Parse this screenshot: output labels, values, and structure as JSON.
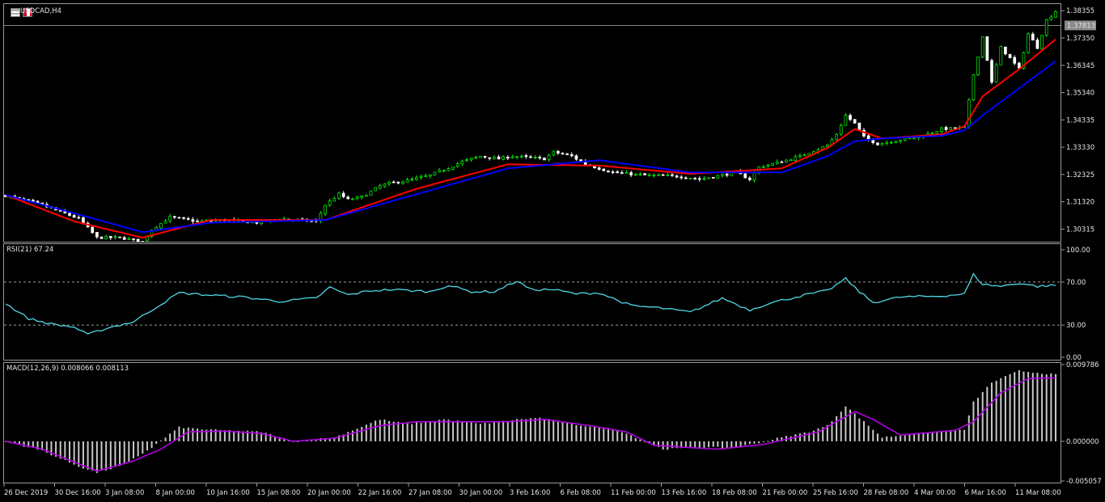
{
  "window": {
    "symbol_label": "USDCAD,H4"
  },
  "price_axis": {
    "ticks": [
      "1.38355",
      "1.37350",
      "1.36345",
      "1.35340",
      "1.34335",
      "1.33330",
      "1.32325",
      "1.31320",
      "1.30315"
    ],
    "current_price": "1.37813"
  },
  "rsi": {
    "label": "RSI(21) 67.24",
    "ticks": [
      "100.00",
      "70.00",
      "30.00",
      "0.00"
    ]
  },
  "macd": {
    "label": "MACD(12,26,9) 0.008066 0.008113",
    "ticks": [
      "0.009786",
      "0.000000",
      "-0.005057"
    ]
  },
  "time_axis": {
    "labels": [
      "26 Dec 2019",
      "30 Dec 16:00",
      "3 Jan 08:00",
      "8 Jan 00:00",
      "10 Jan 16:00",
      "15 Jan 08:00",
      "20 Jan 00:00",
      "22 Jan 16:00",
      "27 Jan 08:00",
      "30 Jan 00:00",
      "3 Feb 16:00",
      "6 Feb 08:00",
      "11 Feb 00:00",
      "13 Feb 16:00",
      "18 Feb 08:00",
      "21 Feb 00:00",
      "25 Feb 16:00",
      "28 Feb 08:00",
      "4 Mar 00:00",
      "6 Mar 16:00",
      "11 Mar 08:00"
    ]
  },
  "colors": {
    "background": "#000000",
    "bull_candle": "#00ff00",
    "bear_candle": "#ffffff",
    "ma_fast": "#ff0000",
    "ma_slow": "#0000ff",
    "rsi_line": "#4fd8e6",
    "macd_histogram": "#c8c8c8",
    "macd_signal": "#b000e0",
    "grid_frame": "#9a9a9a"
  },
  "chart_data": [
    {
      "type": "candlestick",
      "symbol": "USDCAD",
      "timeframe": "H4",
      "ylim": [
        1.2985,
        1.386
      ],
      "close_path": [
        [
          0,
          1.3155
        ],
        [
          8,
          1.312
        ],
        [
          16,
          1.307
        ],
        [
          20,
          1.3
        ],
        [
          25,
          1.3
        ],
        [
          30,
          1.2985
        ],
        [
          32,
          1.303
        ],
        [
          36,
          1.3075
        ],
        [
          42,
          1.306
        ],
        [
          48,
          1.3065
        ],
        [
          55,
          1.3055
        ],
        [
          60,
          1.307
        ],
        [
          68,
          1.306
        ],
        [
          70,
          1.312
        ],
        [
          73,
          1.316
        ],
        [
          75,
          1.314
        ],
        [
          78,
          1.315
        ],
        [
          82,
          1.319
        ],
        [
          84,
          1.32
        ],
        [
          88,
          1.321
        ],
        [
          93,
          1.323
        ],
        [
          96,
          1.325
        ],
        [
          100,
          1.328
        ],
        [
          104,
          1.33
        ],
        [
          108,
          1.329
        ],
        [
          111,
          1.33
        ],
        [
          118,
          1.329
        ],
        [
          120,
          1.3315
        ],
        [
          124,
          1.33
        ],
        [
          127,
          1.327
        ],
        [
          133,
          1.324
        ],
        [
          140,
          1.323
        ],
        [
          148,
          1.3225
        ],
        [
          152,
          1.3215
        ],
        [
          160,
          1.324
        ],
        [
          163,
          1.3215
        ],
        [
          165,
          1.326
        ],
        [
          170,
          1.328
        ],
        [
          174,
          1.33
        ],
        [
          177,
          1.332
        ],
        [
          180,
          1.334
        ],
        [
          182,
          1.338
        ],
        [
          184,
          1.345
        ],
        [
          186,
          1.342
        ],
        [
          188,
          1.337
        ],
        [
          191,
          1.3345
        ],
        [
          194,
          1.3355
        ],
        [
          200,
          1.337
        ],
        [
          205,
          1.34
        ],
        [
          210,
          1.3405
        ],
        [
          212,
          1.36
        ],
        [
          214,
          1.374
        ],
        [
          216,
          1.357
        ],
        [
          218,
          1.37
        ],
        [
          222,
          1.362
        ],
        [
          224,
          1.375
        ],
        [
          226,
          1.37
        ],
        [
          228,
          1.38
        ],
        [
          230,
          1.3833
        ]
      ],
      "moving_averages": [
        {
          "color": "#ff0000",
          "path": [
            [
              0,
              1.3157
            ],
            [
              15,
              1.306
            ],
            [
              30,
              1.3
            ],
            [
              45,
              1.3065
            ],
            [
              70,
              1.3065
            ],
            [
              90,
              1.318
            ],
            [
              110,
              1.327
            ],
            [
              130,
              1.3265
            ],
            [
              150,
              1.3235
            ],
            [
              170,
              1.3255
            ],
            [
              180,
              1.333
            ],
            [
              186,
              1.34
            ],
            [
              192,
              1.3365
            ],
            [
              205,
              1.338
            ],
            [
              210,
              1.341
            ],
            [
              214,
              1.352
            ],
            [
              222,
              1.362
            ],
            [
              230,
              1.373
            ]
          ]
        },
        {
          "color": "#0000ff",
          "path": [
            [
              0,
              1.3157
            ],
            [
              15,
              1.309
            ],
            [
              30,
              1.302
            ],
            [
              45,
              1.3055
            ],
            [
              70,
              1.3065
            ],
            [
              90,
              1.316
            ],
            [
              110,
              1.3255
            ],
            [
              130,
              1.3285
            ],
            [
              150,
              1.324
            ],
            [
              170,
              1.324
            ],
            [
              180,
              1.33
            ],
            [
              186,
              1.3355
            ],
            [
              192,
              1.3365
            ],
            [
              205,
              1.3375
            ],
            [
              210,
              1.3395
            ],
            [
              214,
              1.345
            ],
            [
              222,
              1.355
            ],
            [
              230,
              1.365
            ]
          ]
        }
      ]
    },
    {
      "type": "line",
      "name": "RSI(21)",
      "ylim": [
        0,
        100
      ],
      "levels": [
        70,
        30
      ],
      "path": [
        [
          0,
          50
        ],
        [
          5,
          36
        ],
        [
          10,
          31
        ],
        [
          15,
          28
        ],
        [
          18,
          21
        ],
        [
          22,
          27
        ],
        [
          28,
          33
        ],
        [
          32,
          44
        ],
        [
          38,
          60
        ],
        [
          44,
          58
        ],
        [
          52,
          56
        ],
        [
          60,
          52
        ],
        [
          68,
          55
        ],
        [
          71,
          65
        ],
        [
          75,
          58
        ],
        [
          80,
          62
        ],
        [
          85,
          63
        ],
        [
          93,
          61
        ],
        [
          97,
          67
        ],
        [
          102,
          61
        ],
        [
          107,
          61
        ],
        [
          112,
          71
        ],
        [
          115,
          63
        ],
        [
          120,
          63
        ],
        [
          125,
          59
        ],
        [
          130,
          60
        ],
        [
          137,
          48
        ],
        [
          143,
          46
        ],
        [
          150,
          42
        ],
        [
          157,
          55
        ],
        [
          163,
          44
        ],
        [
          167,
          50
        ],
        [
          170,
          53
        ],
        [
          175,
          58
        ],
        [
          180,
          62
        ],
        [
          184,
          73
        ],
        [
          187,
          61
        ],
        [
          190,
          51
        ],
        [
          196,
          56
        ],
        [
          205,
          57
        ],
        [
          210,
          59
        ],
        [
          212,
          77
        ],
        [
          214,
          68
        ],
        [
          218,
          66
        ],
        [
          222,
          69
        ],
        [
          226,
          66
        ],
        [
          230,
          67
        ]
      ]
    },
    {
      "type": "bar",
      "name": "MACD(12,26,9)",
      "ylim": [
        -0.005057,
        0.009786
      ],
      "histogram_path": [
        [
          0,
          0
        ],
        [
          8,
          -0.0012
        ],
        [
          16,
          -0.0032
        ],
        [
          20,
          -0.004
        ],
        [
          26,
          -0.003
        ],
        [
          32,
          -0.0008
        ],
        [
          38,
          0.0018
        ],
        [
          44,
          0.0015
        ],
        [
          56,
          0.0012
        ],
        [
          63,
          0
        ],
        [
          72,
          0.0005
        ],
        [
          82,
          0.0028
        ],
        [
          88,
          0.0022
        ],
        [
          96,
          0.0028
        ],
        [
          104,
          0.0022
        ],
        [
          112,
          0.0028
        ],
        [
          117,
          0.003
        ],
        [
          124,
          0.0022
        ],
        [
          134,
          0.0015
        ],
        [
          140,
          0
        ],
        [
          144,
          -0.001
        ],
        [
          152,
          -0.0008
        ],
        [
          160,
          -0.0008
        ],
        [
          170,
          0.0005
        ],
        [
          176,
          0.0012
        ],
        [
          180,
          0.002
        ],
        [
          184,
          0.0045
        ],
        [
          188,
          0.0025
        ],
        [
          192,
          0.0005
        ],
        [
          200,
          0.001
        ],
        [
          210,
          0.0015
        ],
        [
          212,
          0.005
        ],
        [
          216,
          0.0075
        ],
        [
          222,
          0.009
        ],
        [
          230,
          0.0085
        ]
      ],
      "signal_path": [
        [
          0,
          0
        ],
        [
          8,
          -0.001
        ],
        [
          20,
          -0.0038
        ],
        [
          28,
          -0.0025
        ],
        [
          34,
          -0.001
        ],
        [
          40,
          0.0012
        ],
        [
          48,
          0.0013
        ],
        [
          56,
          0.001
        ],
        [
          63,
          0
        ],
        [
          72,
          0.0004
        ],
        [
          82,
          0.002
        ],
        [
          90,
          0.0025
        ],
        [
          100,
          0.0025
        ],
        [
          110,
          0.0025
        ],
        [
          118,
          0.0028
        ],
        [
          128,
          0.002
        ],
        [
          136,
          0.0012
        ],
        [
          142,
          -0.0005
        ],
        [
          150,
          -0.0008
        ],
        [
          156,
          -0.001
        ],
        [
          166,
          -0.0004
        ],
        [
          178,
          0.0012
        ],
        [
          186,
          0.0038
        ],
        [
          190,
          0.0028
        ],
        [
          196,
          0.0008
        ],
        [
          208,
          0.0014
        ],
        [
          212,
          0.0025
        ],
        [
          218,
          0.0062
        ],
        [
          224,
          0.008
        ],
        [
          230,
          0.0081
        ]
      ]
    }
  ]
}
